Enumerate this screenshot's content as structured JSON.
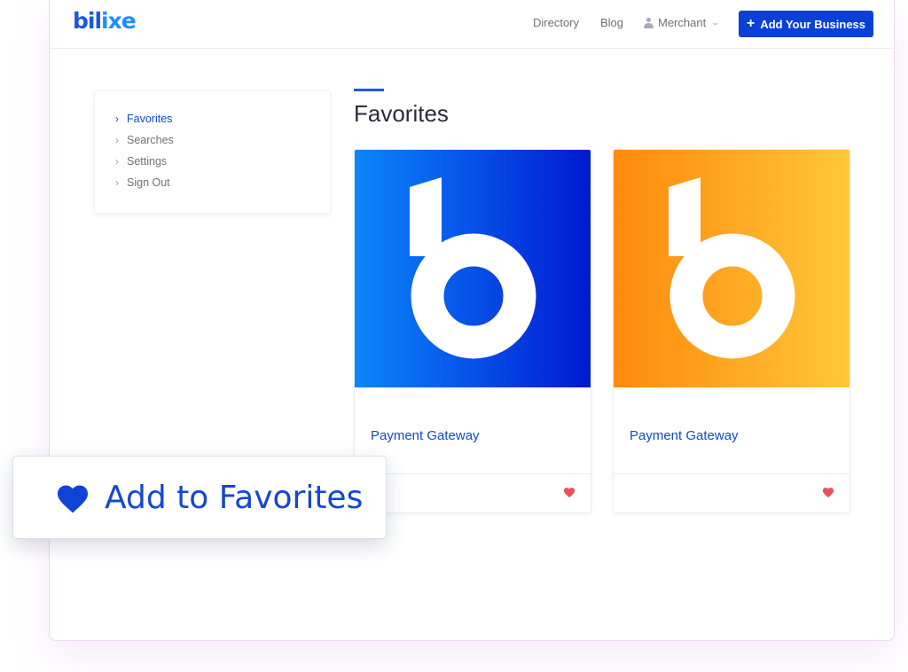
{
  "header": {
    "logo_part1": "bil",
    "logo_part2": "ixe",
    "nav": {
      "directory": "Directory",
      "blog": "Blog",
      "merchant": "Merchant"
    },
    "add_business_label": "Add Your Business"
  },
  "sidebar": {
    "items": [
      {
        "label": "Favorites",
        "active": true
      },
      {
        "label": "Searches",
        "active": false
      },
      {
        "label": "Settings",
        "active": false
      },
      {
        "label": "Sign Out",
        "active": false
      }
    ]
  },
  "main": {
    "title": "Favorites",
    "cards": [
      {
        "name": "Payment Gateway",
        "theme": "blue",
        "colors": [
          "#0b86f8",
          "#0018cf"
        ]
      },
      {
        "name": "Payment Gateway",
        "theme": "orange",
        "colors": [
          "#ff8a0c",
          "#ffc83a"
        ]
      }
    ]
  },
  "popup": {
    "label": "Add to Favorites",
    "icon": "heart-icon"
  },
  "colors": {
    "accent": "#1347d3",
    "button": "#0a3fd8",
    "heart_small": "#e8505b",
    "heart_big": "#0f43d6"
  }
}
